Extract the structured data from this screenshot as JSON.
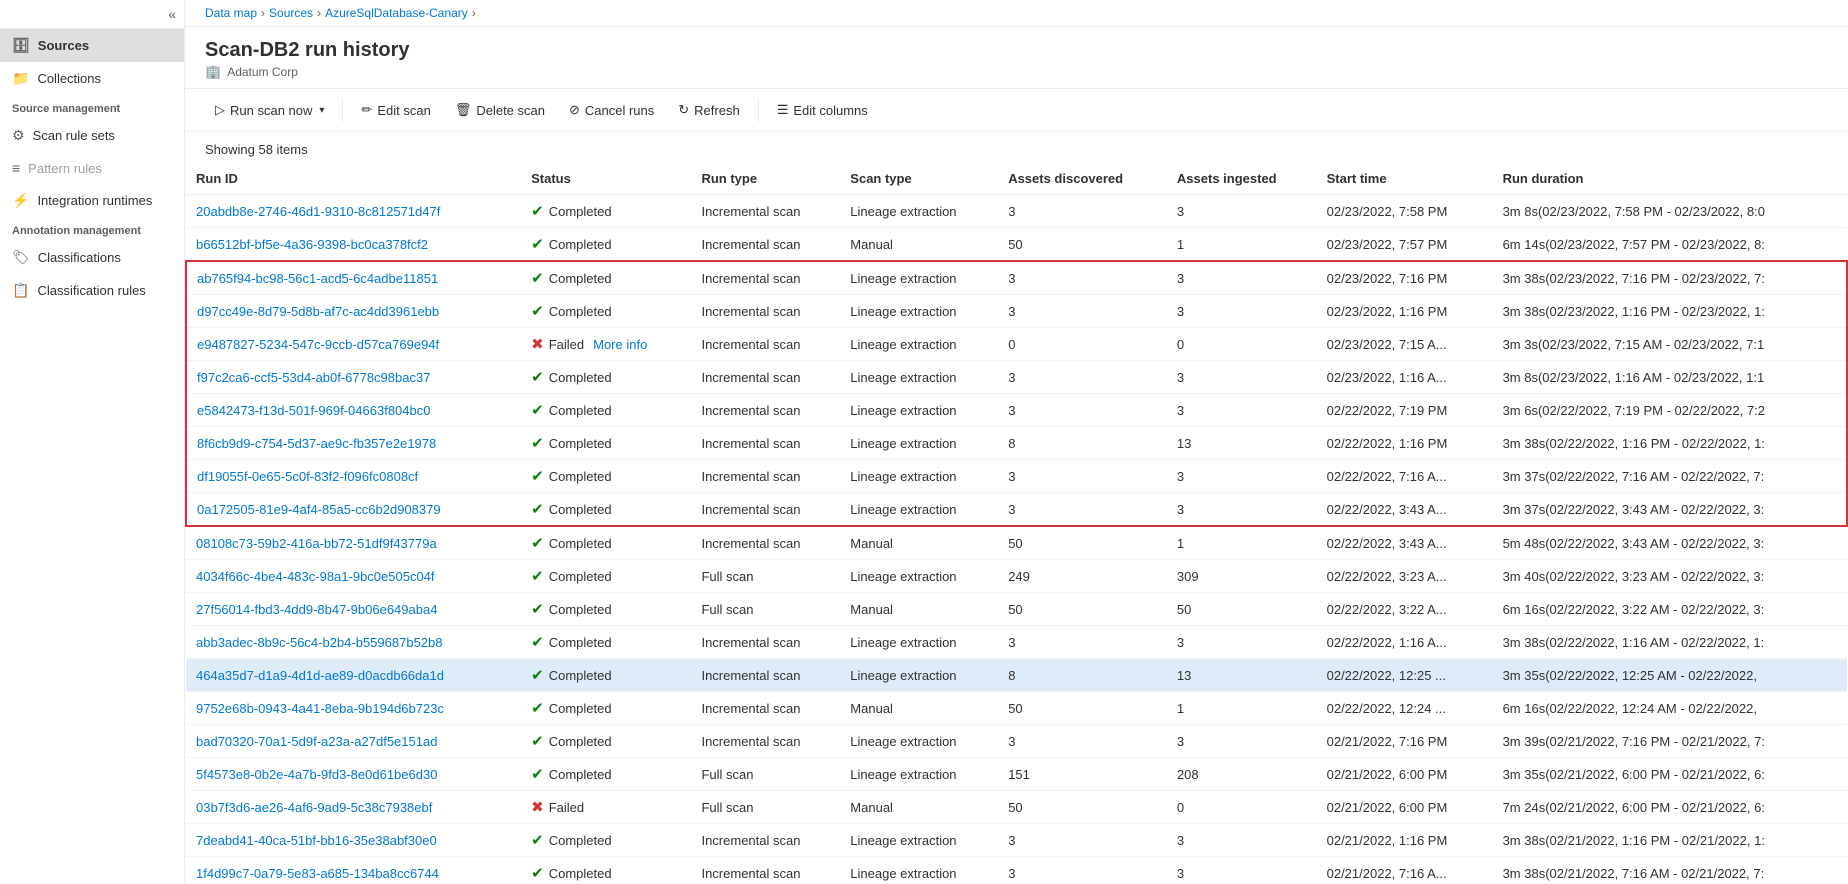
{
  "sidebar": {
    "collapse_icon": "«",
    "items": [
      {
        "id": "sources",
        "label": "Sources",
        "icon": "🗄",
        "active": true
      },
      {
        "id": "collections",
        "label": "Collections",
        "icon": "📁",
        "active": false
      }
    ],
    "source_management_header": "Source management",
    "source_management_items": [
      {
        "id": "scan-rule-sets",
        "label": "Scan rule sets",
        "icon": "⚙",
        "active": false
      },
      {
        "id": "pattern-rules",
        "label": "Pattern rules",
        "icon": "≡",
        "active": false,
        "disabled": true
      },
      {
        "id": "integration-runtimes",
        "label": "Integration runtimes",
        "icon": "⚡",
        "active": false
      }
    ],
    "annotation_management_header": "Annotation management",
    "annotation_management_items": [
      {
        "id": "classifications",
        "label": "Classifications",
        "icon": "🏷",
        "active": false
      },
      {
        "id": "classification-rules",
        "label": "Classification rules",
        "icon": "📋",
        "active": false
      }
    ]
  },
  "breadcrumb": {
    "items": [
      "Data map",
      "Sources",
      "AzureSqlDatabase-Canary"
    ]
  },
  "page": {
    "title": "Scan-DB2 run history",
    "subtitle_icon": "🏢",
    "subtitle": "Adatum Corp"
  },
  "toolbar": {
    "run_scan_label": "Run scan now",
    "edit_scan_label": "Edit scan",
    "delete_scan_label": "Delete scan",
    "cancel_runs_label": "Cancel runs",
    "refresh_label": "Refresh",
    "edit_columns_label": "Edit columns"
  },
  "showing_items": "Showing 58 items",
  "table": {
    "columns": [
      "Run ID",
      "Status",
      "Run type",
      "Scan type",
      "Assets discovered",
      "Assets ingested",
      "Start time",
      "Run duration"
    ],
    "rows": [
      {
        "id": "20abdb8e-2746-46d1-9310-8c812571d47f",
        "status": "Completed",
        "run_type": "Incremental scan",
        "scan_type": "Lineage extraction",
        "assets_discovered": "3",
        "assets_ingested": "3",
        "start_time": "02/23/2022, 7:58 PM",
        "run_duration": "3m 8s(02/23/2022, 7:58 PM - 02/23/2022, 8:0",
        "highlight": false,
        "selected": false
      },
      {
        "id": "b66512bf-bf5e-4a36-9398-bc0ca378fcf2",
        "status": "Completed",
        "run_type": "Incremental scan",
        "scan_type": "Manual",
        "assets_discovered": "50",
        "assets_ingested": "1",
        "start_time": "02/23/2022, 7:57 PM",
        "run_duration": "6m 14s(02/23/2022, 7:57 PM - 02/23/2022, 8:",
        "highlight": false,
        "selected": false
      },
      {
        "id": "ab765f94-bc98-56c1-acd5-6c4adbe11851",
        "status": "Completed",
        "run_type": "Incremental scan",
        "scan_type": "Lineage extraction",
        "assets_discovered": "3",
        "assets_ingested": "3",
        "start_time": "02/23/2022, 7:16 PM",
        "run_duration": "3m 38s(02/23/2022, 7:16 PM - 02/23/2022, 7:",
        "highlight": true,
        "border_top": true,
        "selected": false
      },
      {
        "id": "d97cc49e-8d79-5d8b-af7c-ac4dd3961ebb",
        "status": "Completed",
        "run_type": "Incremental scan",
        "scan_type": "Lineage extraction",
        "assets_discovered": "3",
        "assets_ingested": "3",
        "start_time": "02/23/2022, 1:16 PM",
        "run_duration": "3m 38s(02/23/2022, 1:16 PM - 02/23/2022, 1:",
        "highlight": true,
        "selected": false
      },
      {
        "id": "e9487827-5234-547c-9ccb-d57ca769e94f",
        "status": "Failed",
        "more_info": "More info",
        "run_type": "Incremental scan",
        "scan_type": "Lineage extraction",
        "assets_discovered": "0",
        "assets_ingested": "0",
        "start_time": "02/23/2022, 7:15 A...",
        "run_duration": "3m 3s(02/23/2022, 7:15 AM - 02/23/2022, 7:1",
        "highlight": true,
        "selected": false
      },
      {
        "id": "f97c2ca6-ccf5-53d4-ab0f-6778c98bac37",
        "status": "Completed",
        "run_type": "Incremental scan",
        "scan_type": "Lineage extraction",
        "assets_discovered": "3",
        "assets_ingested": "3",
        "start_time": "02/23/2022, 1:16 A...",
        "run_duration": "3m 8s(02/23/2022, 1:16 AM - 02/23/2022, 1:1",
        "highlight": true,
        "selected": false
      },
      {
        "id": "e5842473-f13d-501f-969f-04663f804bc0",
        "status": "Completed",
        "run_type": "Incremental scan",
        "scan_type": "Lineage extraction",
        "assets_discovered": "3",
        "assets_ingested": "3",
        "start_time": "02/22/2022, 7:19 PM",
        "run_duration": "3m 6s(02/22/2022, 7:19 PM - 02/22/2022, 7:2",
        "highlight": true,
        "selected": false
      },
      {
        "id": "8f6cb9d9-c754-5d37-ae9c-fb357e2e1978",
        "status": "Completed",
        "run_type": "Incremental scan",
        "scan_type": "Lineage extraction",
        "assets_discovered": "8",
        "assets_ingested": "13",
        "start_time": "02/22/2022, 1:16 PM",
        "run_duration": "3m 38s(02/22/2022, 1:16 PM - 02/22/2022, 1:",
        "highlight": true,
        "selected": false
      },
      {
        "id": "df19055f-0e65-5c0f-83f2-f096fc0808cf",
        "status": "Completed",
        "run_type": "Incremental scan",
        "scan_type": "Lineage extraction",
        "assets_discovered": "3",
        "assets_ingested": "3",
        "start_time": "02/22/2022, 7:16 A...",
        "run_duration": "3m 37s(02/22/2022, 7:16 AM - 02/22/2022, 7:",
        "highlight": true,
        "selected": false
      },
      {
        "id": "0a172505-81e9-4af4-85a5-cc6b2d908379",
        "status": "Completed",
        "run_type": "Incremental scan",
        "scan_type": "Lineage extraction",
        "assets_discovered": "3",
        "assets_ingested": "3",
        "start_time": "02/22/2022, 3:43 A...",
        "run_duration": "3m 37s(02/22/2022, 3:43 AM - 02/22/2022, 3:",
        "highlight": true,
        "border_bottom": true,
        "selected": false
      },
      {
        "id": "08108c73-59b2-416a-bb72-51df9f43779a",
        "status": "Completed",
        "run_type": "Incremental scan",
        "scan_type": "Manual",
        "assets_discovered": "50",
        "assets_ingested": "1",
        "start_time": "02/22/2022, 3:43 A...",
        "run_duration": "5m 48s(02/22/2022, 3:43 AM - 02/22/2022, 3:",
        "highlight": false,
        "selected": false
      },
      {
        "id": "4034f66c-4be4-483c-98a1-9bc0e505c04f",
        "status": "Completed",
        "run_type": "Full scan",
        "scan_type": "Lineage extraction",
        "assets_discovered": "249",
        "assets_ingested": "309",
        "start_time": "02/22/2022, 3:23 A...",
        "run_duration": "3m 40s(02/22/2022, 3:23 AM - 02/22/2022, 3:",
        "highlight": false,
        "selected": false
      },
      {
        "id": "27f56014-fbd3-4dd9-8b47-9b06e649aba4",
        "status": "Completed",
        "run_type": "Full scan",
        "scan_type": "Manual",
        "assets_discovered": "50",
        "assets_ingested": "50",
        "start_time": "02/22/2022, 3:22 A...",
        "run_duration": "6m 16s(02/22/2022, 3:22 AM - 02/22/2022, 3:",
        "highlight": false,
        "selected": false
      },
      {
        "id": "abb3adec-8b9c-56c4-b2b4-b559687b52b8",
        "status": "Completed",
        "run_type": "Incremental scan",
        "scan_type": "Lineage extraction",
        "assets_discovered": "3",
        "assets_ingested": "3",
        "start_time": "02/22/2022, 1:16 A...",
        "run_duration": "3m 38s(02/22/2022, 1:16 AM - 02/22/2022, 1:",
        "highlight": false,
        "selected": false
      },
      {
        "id": "464a35d7-d1a9-4d1d-ae89-d0acdb66da1d",
        "status": "Completed",
        "run_type": "Incremental scan",
        "scan_type": "Lineage extraction",
        "assets_discovered": "8",
        "assets_ingested": "13",
        "start_time": "02/22/2022, 12:25 ...",
        "run_duration": "3m 35s(02/22/2022, 12:25 AM - 02/22/2022,",
        "highlight": false,
        "selected": true
      },
      {
        "id": "9752e68b-0943-4a41-8eba-9b194d6b723c",
        "status": "Completed",
        "run_type": "Incremental scan",
        "scan_type": "Manual",
        "assets_discovered": "50",
        "assets_ingested": "1",
        "start_time": "02/22/2022, 12:24 ...",
        "run_duration": "6m 16s(02/22/2022, 12:24 AM - 02/22/2022,",
        "highlight": false,
        "selected": false
      },
      {
        "id": "bad70320-70a1-5d9f-a23a-a27df5e151ad",
        "status": "Completed",
        "run_type": "Incremental scan",
        "scan_type": "Lineage extraction",
        "assets_discovered": "3",
        "assets_ingested": "3",
        "start_time": "02/21/2022, 7:16 PM",
        "run_duration": "3m 39s(02/21/2022, 7:16 PM - 02/21/2022, 7:",
        "highlight": false,
        "selected": false
      },
      {
        "id": "5f4573e8-0b2e-4a7b-9fd3-8e0d61be6d30",
        "status": "Completed",
        "run_type": "Full scan",
        "scan_type": "Lineage extraction",
        "assets_discovered": "151",
        "assets_ingested": "208",
        "start_time": "02/21/2022, 6:00 PM",
        "run_duration": "3m 35s(02/21/2022, 6:00 PM - 02/21/2022, 6:",
        "highlight": false,
        "selected": false
      },
      {
        "id": "03b7f3d6-ae26-4af6-9ad9-5c38c7938ebf",
        "status": "Failed",
        "run_type": "Full scan",
        "scan_type": "Manual",
        "assets_discovered": "50",
        "assets_ingested": "0",
        "start_time": "02/21/2022, 6:00 PM",
        "run_duration": "7m 24s(02/21/2022, 6:00 PM - 02/21/2022, 6:",
        "highlight": false,
        "selected": false
      },
      {
        "id": "7deabd41-40ca-51bf-bb16-35e38abf30e0",
        "status": "Completed",
        "run_type": "Incremental scan",
        "scan_type": "Lineage extraction",
        "assets_discovered": "3",
        "assets_ingested": "3",
        "start_time": "02/21/2022, 1:16 PM",
        "run_duration": "3m 38s(02/21/2022, 1:16 PM - 02/21/2022, 1:",
        "highlight": false,
        "selected": false
      },
      {
        "id": "1f4d99c7-0a79-5e83-a685-134ba8cc6744",
        "status": "Completed",
        "run_type": "Incremental scan",
        "scan_type": "Lineage extraction",
        "assets_discovered": "3",
        "assets_ingested": "3",
        "start_time": "02/21/2022, 7:16 A...",
        "run_duration": "3m 38s(02/21/2022, 7:16 AM - 02/21/2022, 7:",
        "highlight": false,
        "selected": false
      }
    ]
  }
}
